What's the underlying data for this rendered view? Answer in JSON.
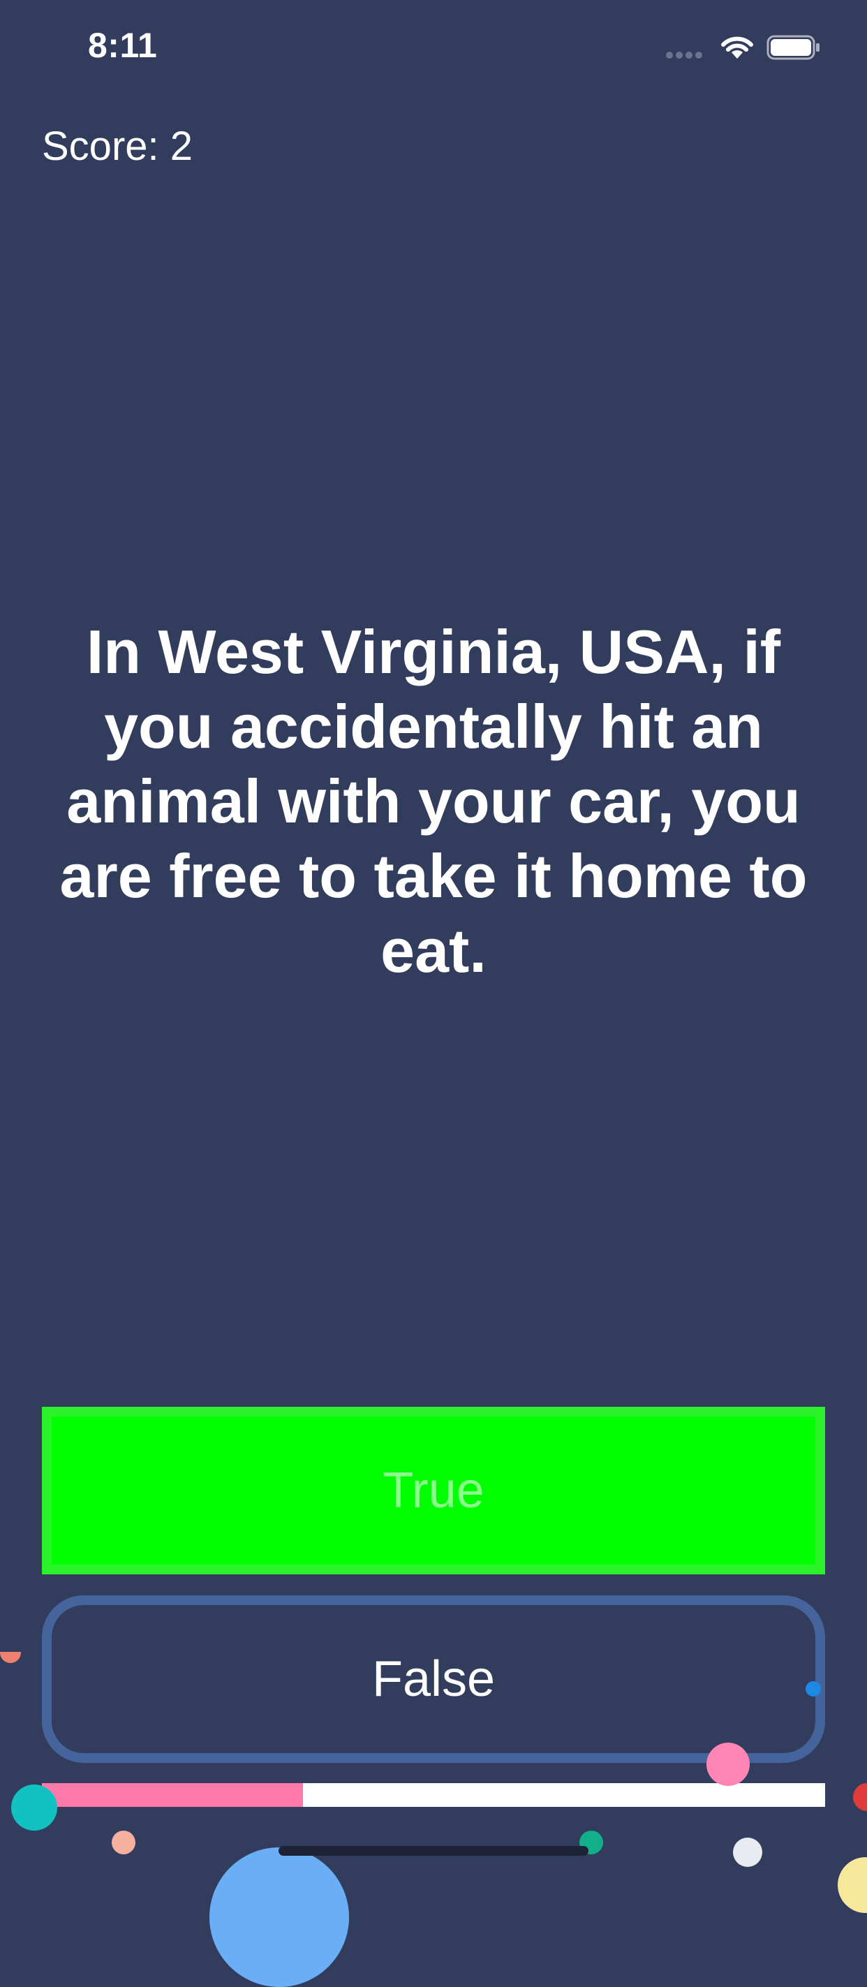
{
  "status_bar": {
    "time": "8:11"
  },
  "score_text": "Score: 2",
  "question": "In West Virginia, USA, if you accidentally hit an animal with your car, you are free to take it home to eat.",
  "answers": {
    "true_label": "True",
    "false_label": "False"
  },
  "progress": {
    "fraction": 0.333
  },
  "colors": {
    "background": "#323c5c",
    "true_button": "#00ff00",
    "false_button_border": "#46649c",
    "progress_fill": "#ff7aa8",
    "progress_track": "#ffffff"
  }
}
